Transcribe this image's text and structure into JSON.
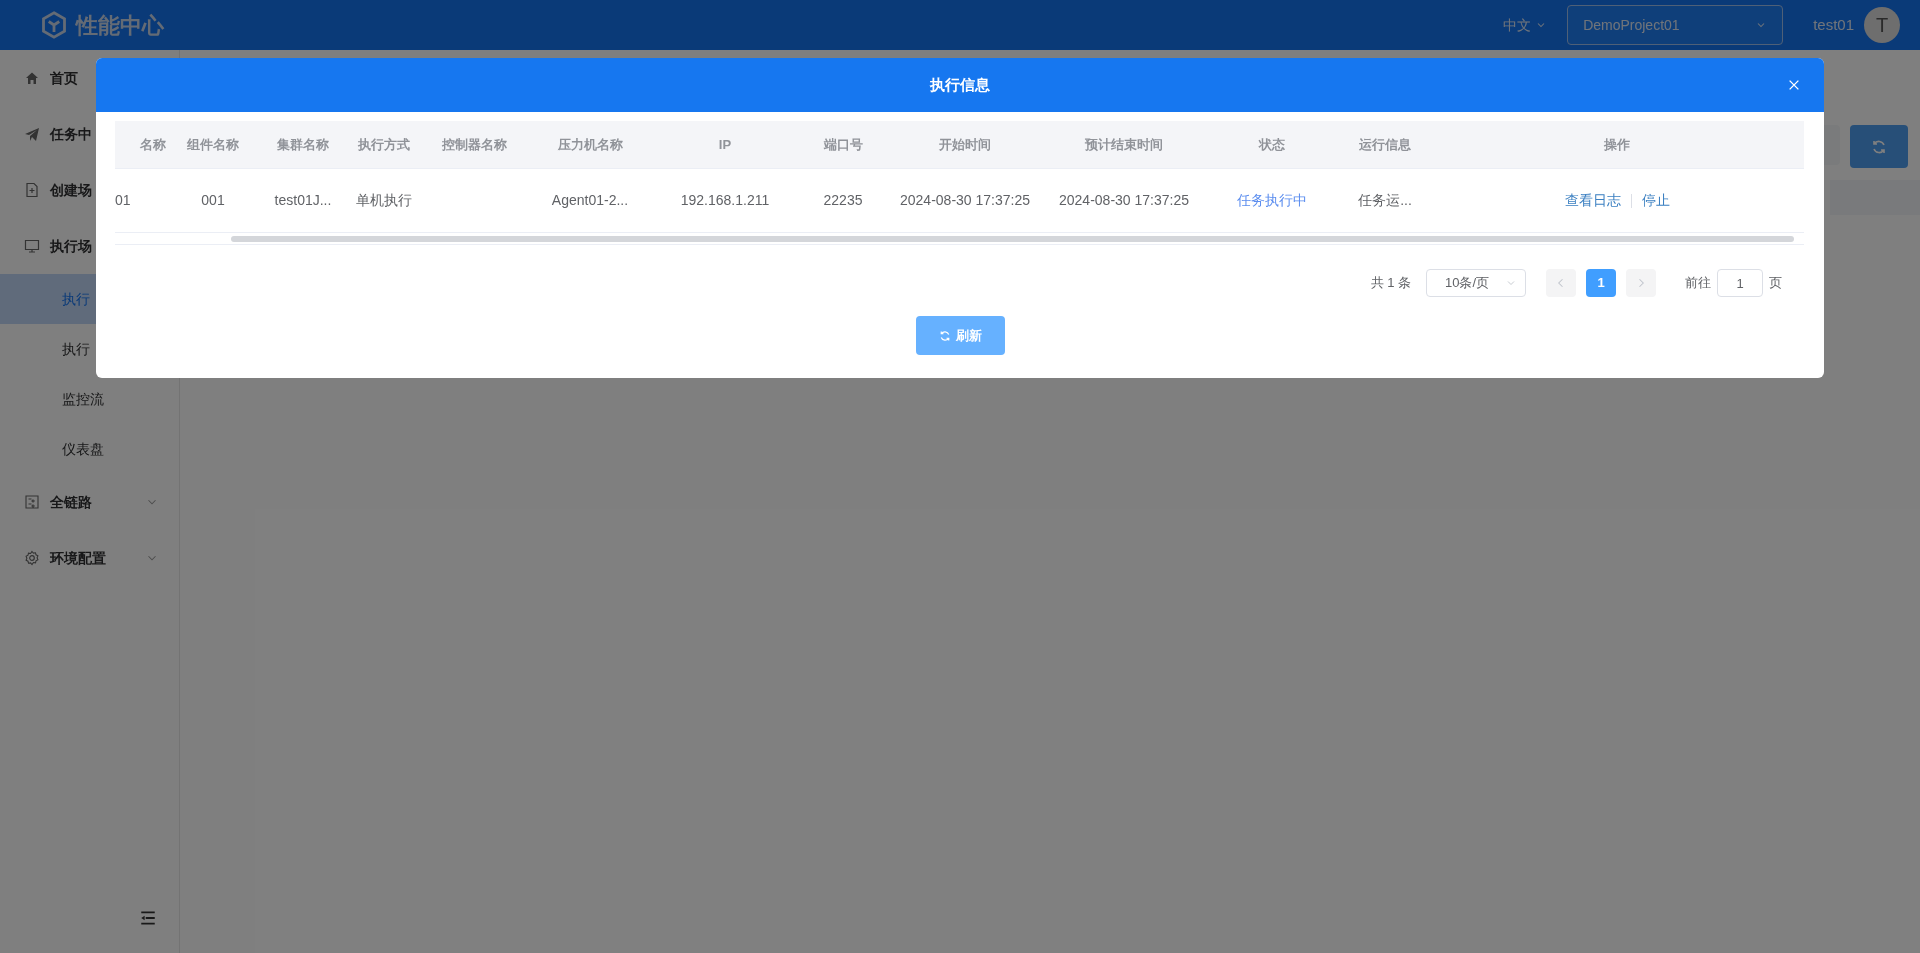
{
  "header": {
    "logo_text": "性能中心",
    "language": "中文",
    "project": "DemoProject01",
    "user": "test01",
    "avatar_letter": "T"
  },
  "sidebar": {
    "items": [
      {
        "label": "首页",
        "kind": "home"
      },
      {
        "label": "任务中",
        "kind": "send"
      },
      {
        "label": "创建场",
        "kind": "file"
      },
      {
        "label": "执行场",
        "kind": "monitor",
        "expanded": true,
        "children": [
          {
            "label": "执行",
            "selected": true
          },
          {
            "label": "执行",
            "selected": false
          },
          {
            "label": "监控流",
            "selected": false
          },
          {
            "label": "仪表盘",
            "selected": false
          }
        ]
      },
      {
        "label": "全链路",
        "kind": "panel",
        "expanded": false
      },
      {
        "label": "环境配置",
        "kind": "gear",
        "expanded": false
      }
    ]
  },
  "modal": {
    "title": "执行信息",
    "table": {
      "columns": [
        "名称",
        "组件名称",
        "集群名称",
        "执行方式",
        "控制器名称",
        "压力机名称",
        "IP",
        "端口号",
        "开始时间",
        "预计结束时间",
        "状态",
        "运行信息",
        "操作"
      ],
      "rows": [
        {
          "cells": [
            {
              "kind": "text",
              "text": "01"
            },
            {
              "kind": "text",
              "text": "001"
            },
            {
              "kind": "text",
              "text": "test01J..."
            },
            {
              "kind": "text",
              "text": "单机执行"
            },
            {
              "kind": "empty"
            },
            {
              "kind": "text",
              "text": "Agent01-2..."
            },
            {
              "kind": "text",
              "text": "192.168.1.211"
            },
            {
              "kind": "text",
              "text": "22235"
            },
            {
              "kind": "text",
              "text": "2024-08-30 17:37:25"
            },
            {
              "kind": "text",
              "text": "2024-08-30 17:37:25"
            },
            {
              "kind": "status",
              "text": "任务执行中"
            },
            {
              "kind": "text",
              "text": "任务运..."
            },
            {
              "kind": "actions",
              "actions": [
                "查看日志",
                "停止"
              ]
            }
          ]
        }
      ]
    },
    "pagination": {
      "total": "共 1 条",
      "page_size": "10条/页",
      "prev_disabled": true,
      "next_disabled": true,
      "pages": [
        {
          "label": "1",
          "selected": true
        }
      ],
      "goto_label": "前往",
      "goto_value": "1",
      "goto_suffix": "页"
    },
    "refresh_button": "刷新"
  }
}
